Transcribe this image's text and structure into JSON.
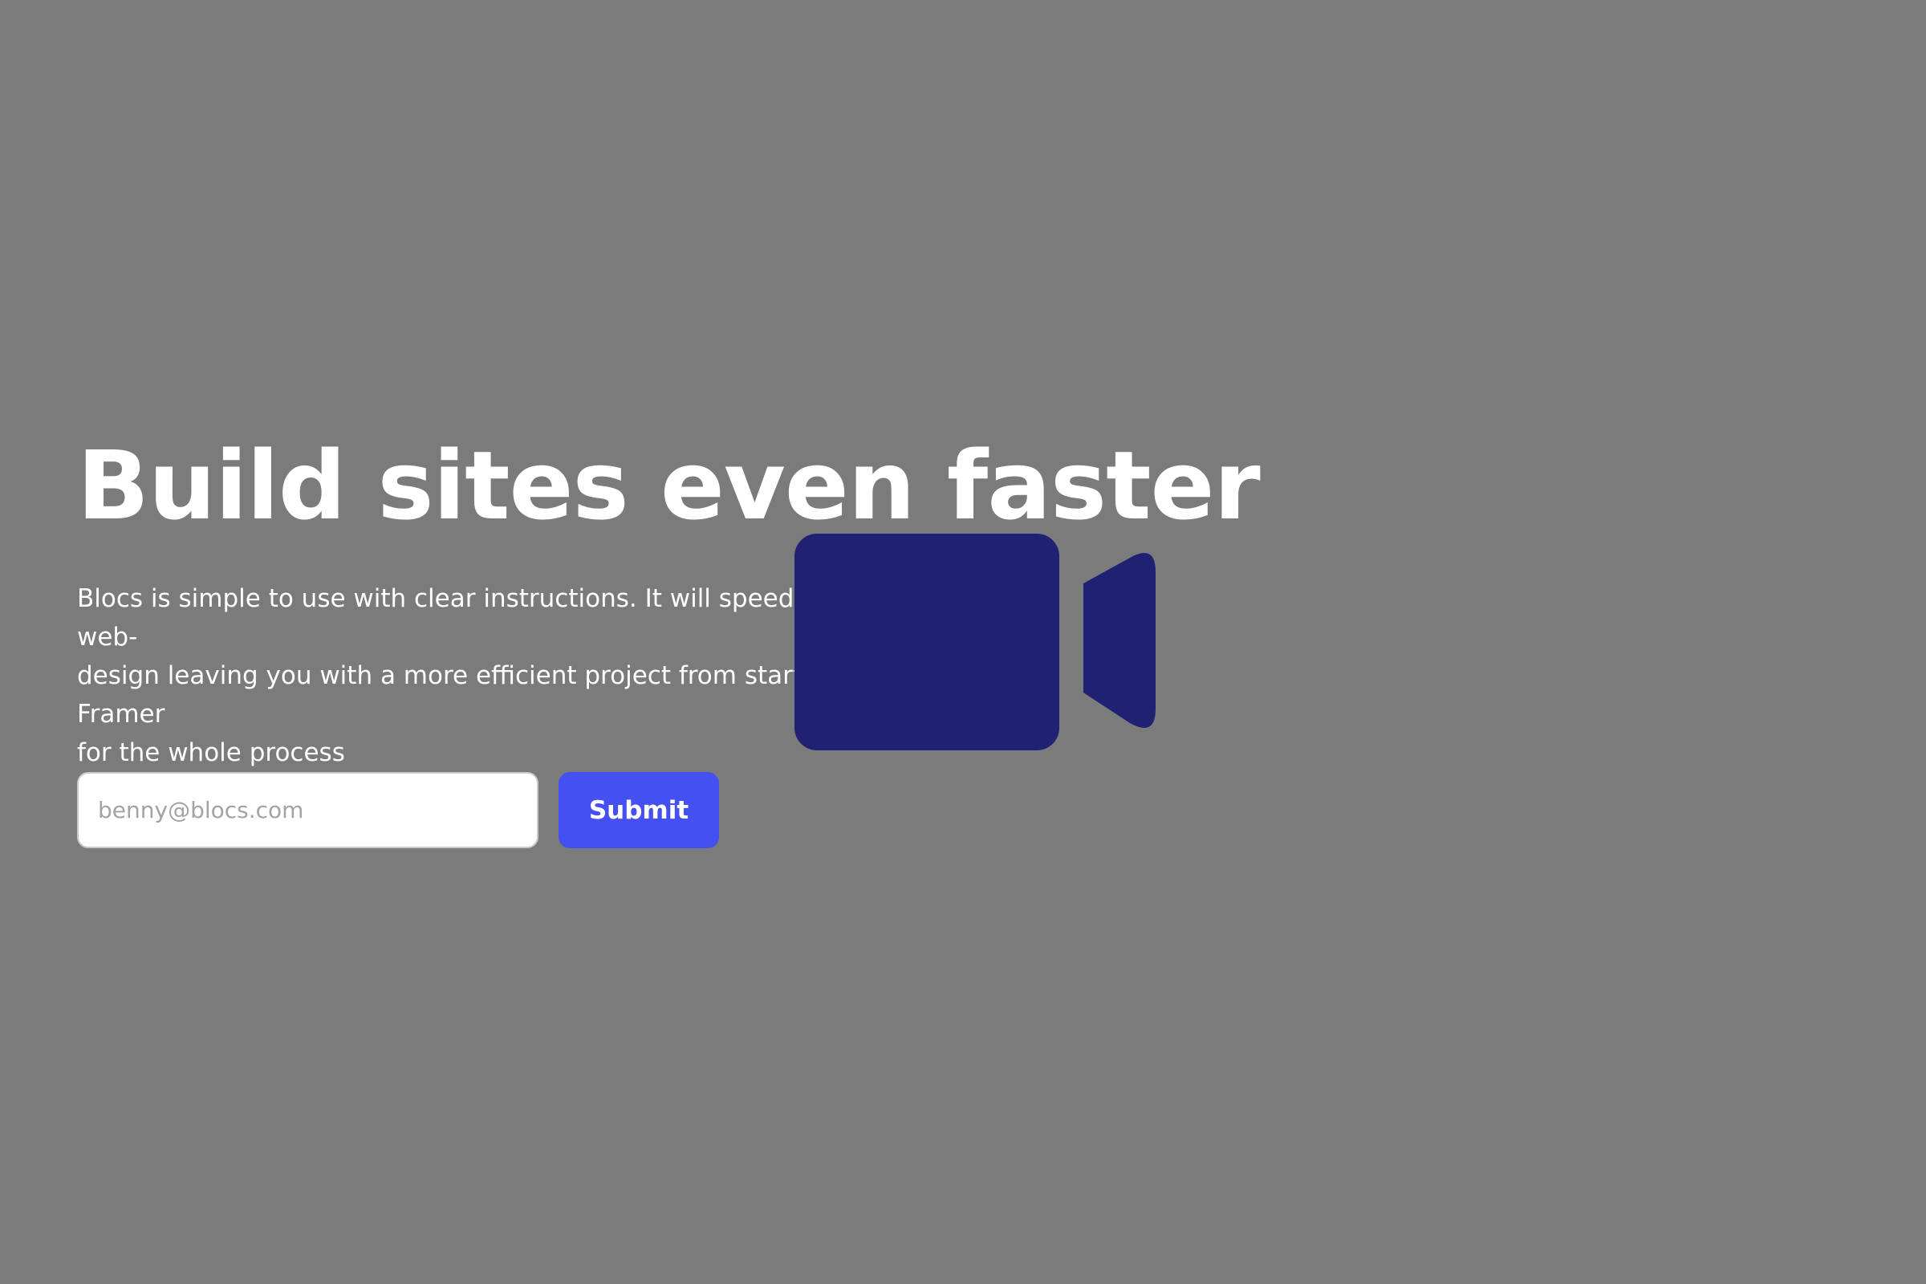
{
  "hero": {
    "title": "Build sites even faster",
    "description": "Blocs is simple to use with clear instructions. It will speed up the process for web-\ndesign leaving you with a more efficient project from start to finish. Stay in Framer\nfor the whole process"
  },
  "form": {
    "email_placeholder": "benny@blocs.com",
    "submit_label": "Submit"
  },
  "icons": {
    "video": "video-camera-icon"
  },
  "colors": {
    "background": "#7b7b7b",
    "text": "#ffffff",
    "accent": "#4550f0",
    "icon": "#1f2273"
  }
}
